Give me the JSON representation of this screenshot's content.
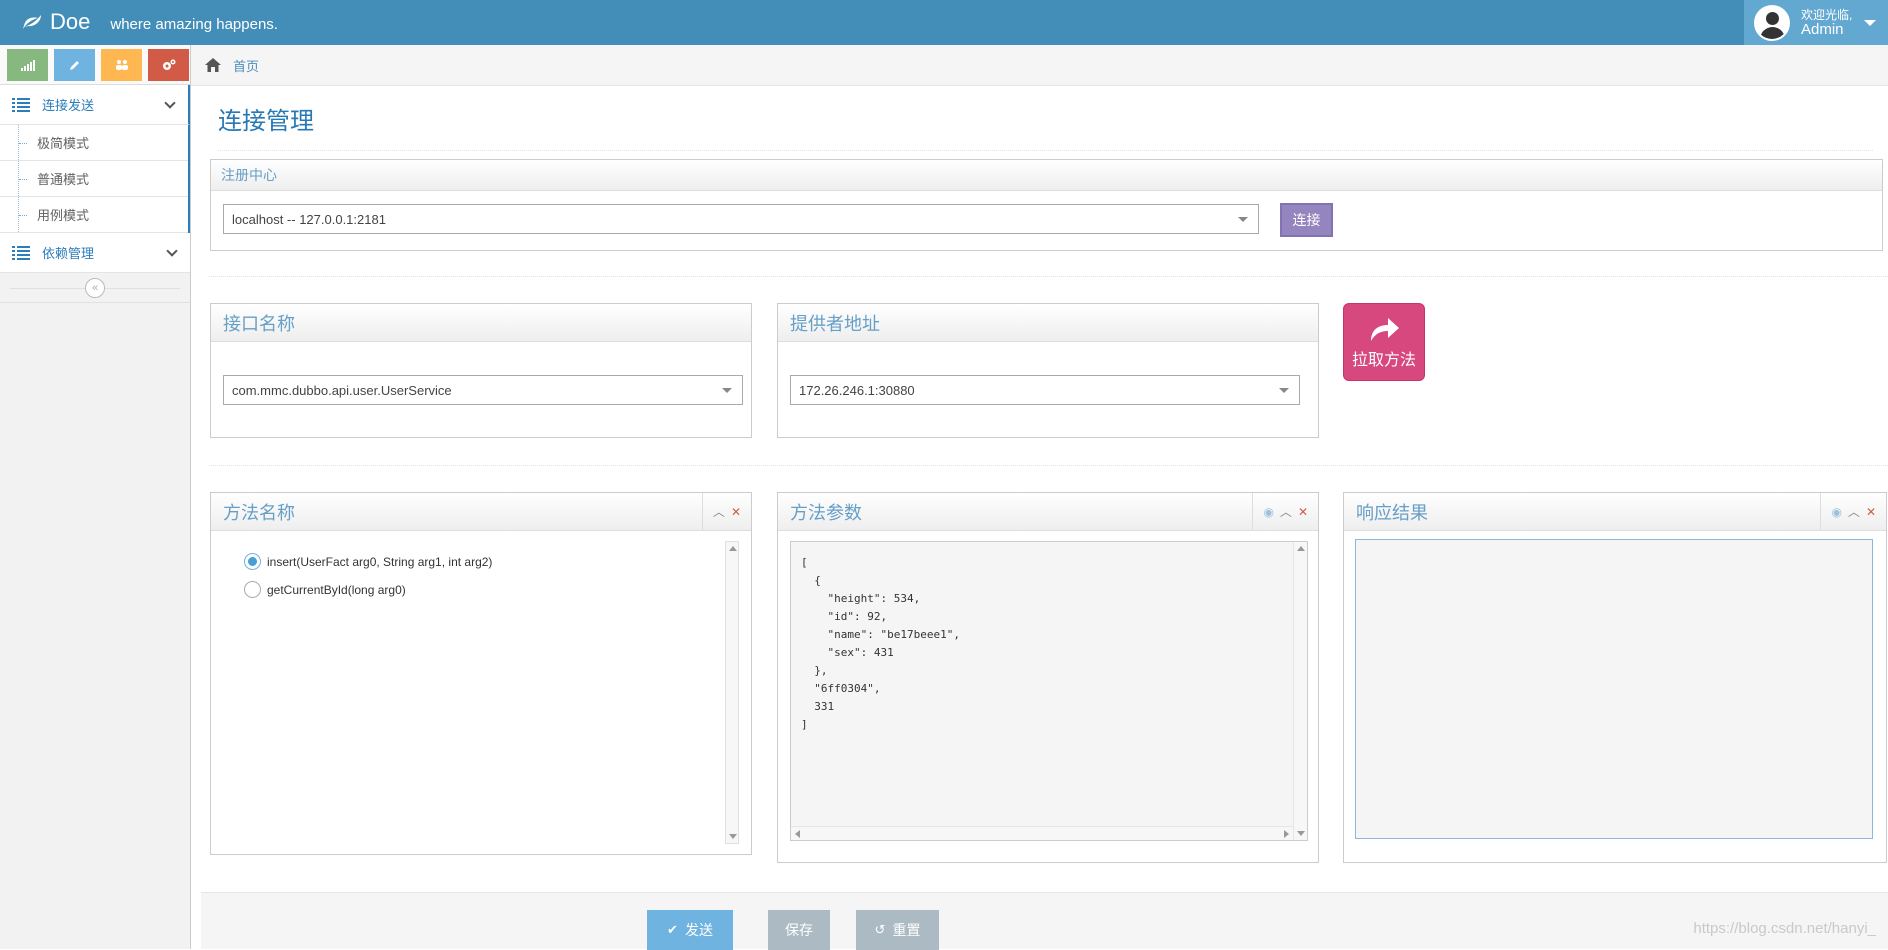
{
  "navbar": {
    "brand": "Doe",
    "slogan": "where amazing happens.",
    "user": {
      "greeting": "欢迎光临,",
      "name": "Admin"
    }
  },
  "sidebar": {
    "shortcut_icons": [
      "signal-icon",
      "pencil-icon",
      "users-icon",
      "cogs-icon"
    ],
    "menus": [
      {
        "label": "连接发送",
        "items": [
          "极简模式",
          "普通模式",
          "用例模式"
        ]
      },
      {
        "label": "依赖管理"
      }
    ],
    "collapse_icon": "double-angle-left-icon"
  },
  "breadcrumb": {
    "home": "首页"
  },
  "page": {
    "title": "连接管理"
  },
  "registry": {
    "title": "注册中心",
    "selected": "localhost -- 127.0.0.1:2181",
    "connect_label": "连接"
  },
  "interface": {
    "title": "接口名称",
    "selected": "com.mmc.dubbo.api.user.UserService"
  },
  "provider": {
    "title": "提供者地址",
    "selected": "172.26.246.1:30880"
  },
  "pull_button": {
    "label": "拉取方法"
  },
  "methods": {
    "title": "方法名称",
    "options": [
      {
        "label": "insert(UserFact arg0, String arg1, int arg2)",
        "checked": true
      },
      {
        "label": "getCurrentById(long arg0)",
        "checked": false
      }
    ]
  },
  "params": {
    "title": "方法参数",
    "json": "[\n  {\n    \"height\": 534,\n    \"id\": 92,\n    \"name\": \"be17beee1\",\n    \"sex\": 431\n  },\n  \"6ff0304\",\n  331\n]"
  },
  "response": {
    "title": "响应结果",
    "body": ""
  },
  "actions": {
    "send": "发送",
    "save": "保存",
    "reset": "重置"
  },
  "watermark": "https://blog.csdn.net/hanyi_",
  "colors": {
    "navbar": "#438eb9",
    "accent": "#2679b5",
    "pink": "#d6487e",
    "purple": "#9585bf"
  }
}
